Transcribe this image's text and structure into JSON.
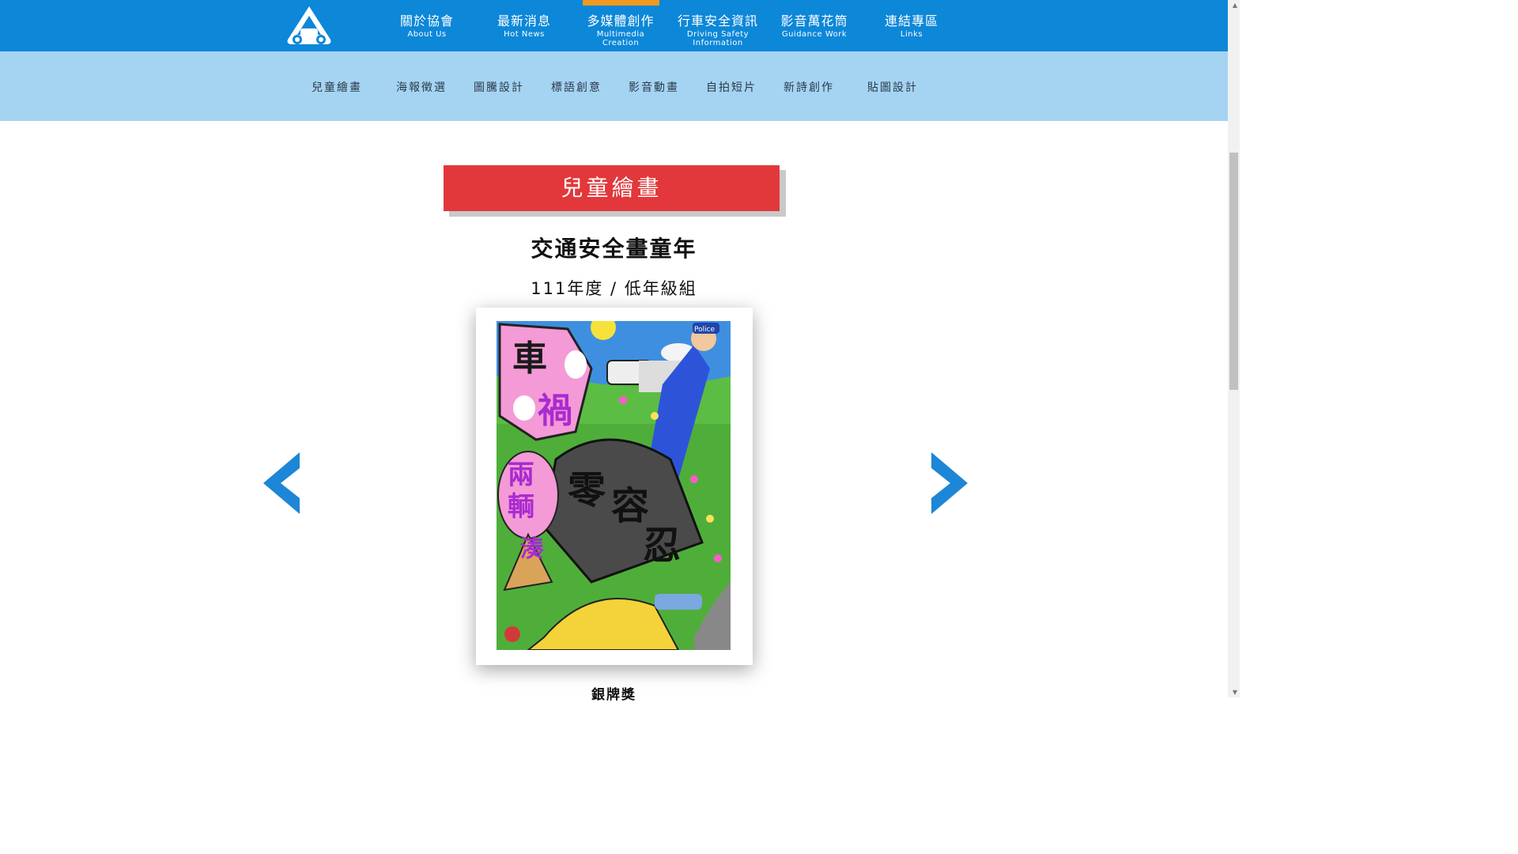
{
  "nav": {
    "items": [
      {
        "zh": "關於協會",
        "en": "About Us"
      },
      {
        "zh": "最新消息",
        "en": "Hot News"
      },
      {
        "zh": "多媒體創作",
        "en": "Multimedia Creation"
      },
      {
        "zh": "行車安全資訊",
        "en": "Driving Safety Information"
      },
      {
        "zh": "影音萬花筒",
        "en": "Guidance Work"
      },
      {
        "zh": "連結專區",
        "en": "Links"
      }
    ],
    "active_color": "#f39a1e",
    "bar_color": "#0d87d8"
  },
  "subnav": {
    "items": [
      "兒童繪畫",
      "海報徵選",
      "圖騰設計",
      "標語創意",
      "影音動畫",
      "自拍短片",
      "新詩創作",
      "貼圖設計"
    ],
    "bar_color": "#a5d4f3"
  },
  "section": {
    "banner": "兒童繪畫",
    "banner_color": "#e2383b",
    "title": "交通安全畫童年",
    "subtitle": "111年度 / 低年級組",
    "award": "銀牌獎"
  },
  "painting": {
    "texts": [
      "車",
      "禍",
      "兩",
      "輌",
      "湊",
      "零",
      "容",
      "忍",
      "Police"
    ]
  },
  "icons": {
    "logo": "car-logo-icon",
    "prev": "chevron-left-icon",
    "next": "chevron-right-icon"
  }
}
